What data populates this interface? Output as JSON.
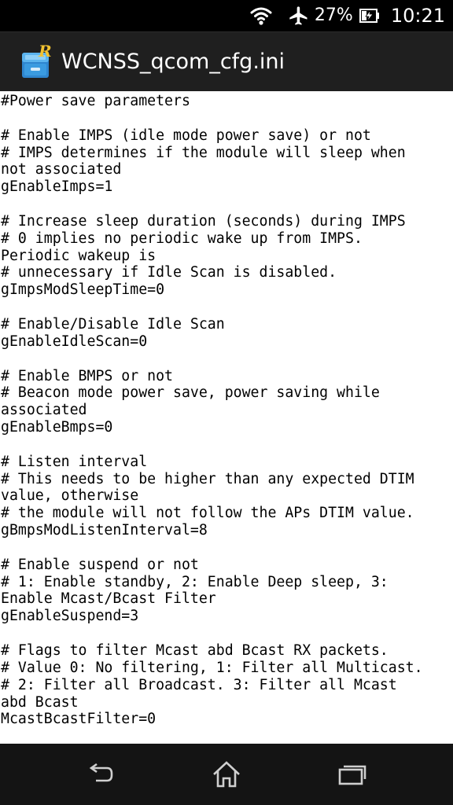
{
  "status_bar": {
    "battery_percent": "27%",
    "time": "10:21",
    "icons": [
      "wifi-icon",
      "airplane-mode-icon",
      "battery-charging-icon"
    ]
  },
  "app_bar": {
    "title": "WCNSS_qcom_cfg.ini",
    "app_icon": "file-manager-app-icon"
  },
  "file": {
    "lines": [
      "#Power save parameters",
      "",
      "# Enable IMPS (idle mode power save) or not",
      "# IMPS determines if the module will sleep when",
      "not associated",
      "gEnableImps=1",
      "",
      "# Increase sleep duration (seconds) during IMPS",
      "# 0 implies no periodic wake up from IMPS.",
      "Periodic wakeup is",
      "# unnecessary if Idle Scan is disabled.",
      "gImpsModSleepTime=0",
      "",
      "# Enable/Disable Idle Scan",
      "gEnableIdleScan=0",
      "",
      "# Enable BMPS or not",
      "# Beacon mode power save, power saving while",
      "associated",
      "gEnableBmps=0",
      "",
      "# Listen interval",
      "# This needs to be higher than any expected DTIM",
      "value, otherwise",
      "# the module will not follow the APs DTIM value.",
      "gBmpsModListenInterval=8",
      "",
      "# Enable suspend or not",
      "# 1: Enable standby, 2: Enable Deep sleep, 3:",
      "Enable Mcast/Bcast Filter",
      "gEnableSuspend=3",
      "",
      "# Flags to filter Mcast abd Bcast RX packets.",
      "# Value 0: No filtering, 1: Filter all Multicast.",
      "# 2: Filter all Broadcast. 3: Filter all Mcast",
      "abd Bcast",
      "McastBcastFilter=0",
      "",
      ""
    ]
  },
  "nav_bar": {
    "buttons": [
      "back-icon",
      "home-icon",
      "recent-apps-icon"
    ]
  },
  "colors": {
    "status_bar": "#000000",
    "action_bar": "#1f1f1f",
    "nav_bar": "#141414",
    "content_bg": "#ffffff",
    "text": "#000000",
    "app_icon_blue": "#3a9be0"
  }
}
